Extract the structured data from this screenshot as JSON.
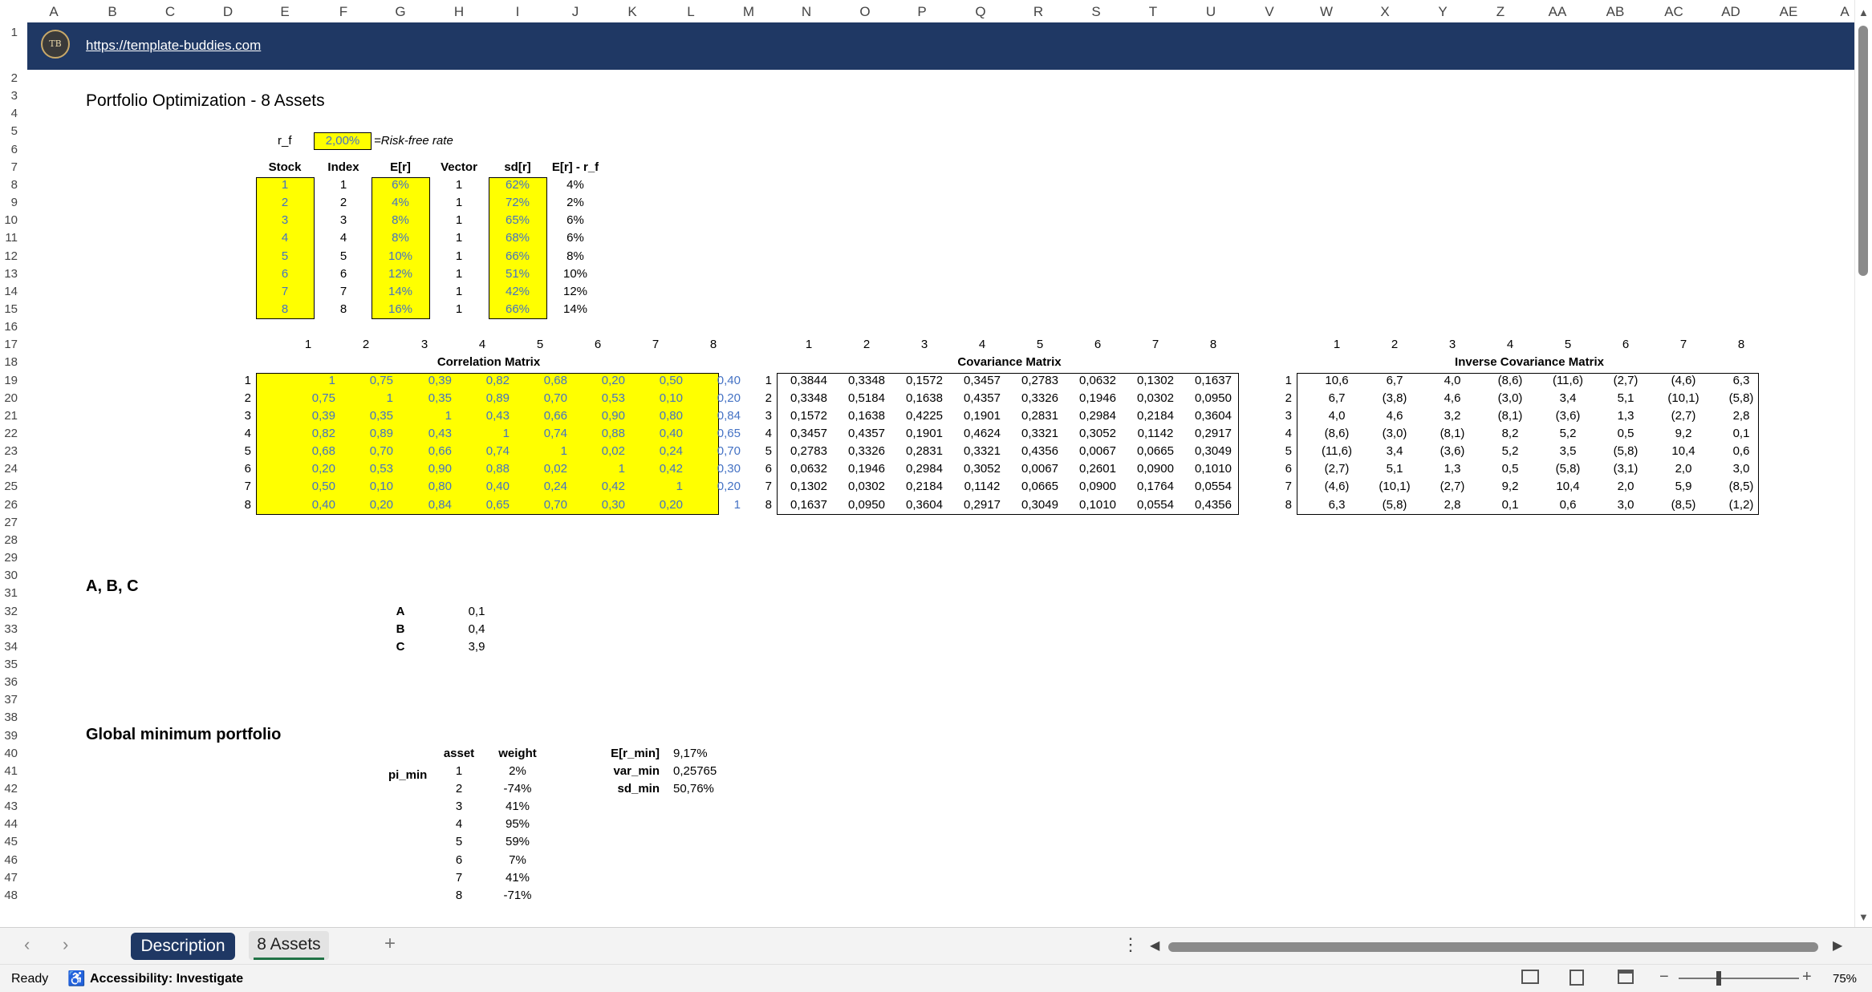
{
  "columns": [
    "A",
    "B",
    "C",
    "D",
    "E",
    "F",
    "G",
    "H",
    "I",
    "J",
    "K",
    "L",
    "M",
    "N",
    "O",
    "P",
    "Q",
    "R",
    "S",
    "T",
    "U",
    "V",
    "W",
    "X",
    "Y",
    "Z",
    "AA",
    "AB",
    "AC",
    "AD",
    "AE",
    "A"
  ],
  "link": "https://template-buddies.com",
  "logo_text": "TB",
  "title": "Portfolio Optimization - 8 Assets",
  "rf": {
    "label": "r_f",
    "value": "2,00%",
    "note": "=Risk-free rate"
  },
  "stock_table": {
    "headers": [
      "Stock",
      "Index",
      "E[r]",
      "Vector",
      "sd[r]",
      "E[r] - r_f"
    ],
    "rows": [
      [
        "1",
        "1",
        "6%",
        "1",
        "62%",
        "4%"
      ],
      [
        "2",
        "2",
        "4%",
        "1",
        "72%",
        "2%"
      ],
      [
        "3",
        "3",
        "8%",
        "1",
        "65%",
        "6%"
      ],
      [
        "4",
        "4",
        "8%",
        "1",
        "68%",
        "6%"
      ],
      [
        "5",
        "5",
        "10%",
        "1",
        "66%",
        "8%"
      ],
      [
        "6",
        "6",
        "12%",
        "1",
        "51%",
        "10%"
      ],
      [
        "7",
        "7",
        "14%",
        "1",
        "42%",
        "12%"
      ],
      [
        "8",
        "8",
        "16%",
        "1",
        "66%",
        "14%"
      ]
    ]
  },
  "matrix_index": [
    "1",
    "2",
    "3",
    "4",
    "5",
    "6",
    "7",
    "8"
  ],
  "correlation": {
    "title": "Correlation Matrix",
    "rows": [
      [
        "1",
        "0,75",
        "0,39",
        "0,82",
        "0,68",
        "0,20",
        "0,50",
        "0,40"
      ],
      [
        "0,75",
        "1",
        "0,35",
        "0,89",
        "0,70",
        "0,53",
        "0,10",
        "0,20"
      ],
      [
        "0,39",
        "0,35",
        "1",
        "0,43",
        "0,66",
        "0,90",
        "0,80",
        "0,84"
      ],
      [
        "0,82",
        "0,89",
        "0,43",
        "1",
        "0,74",
        "0,88",
        "0,40",
        "0,65"
      ],
      [
        "0,68",
        "0,70",
        "0,66",
        "0,74",
        "1",
        "0,02",
        "0,24",
        "0,70"
      ],
      [
        "0,20",
        "0,53",
        "0,90",
        "0,88",
        "0,02",
        "1",
        "0,42",
        "0,30"
      ],
      [
        "0,50",
        "0,10",
        "0,80",
        "0,40",
        "0,24",
        "0,42",
        "1",
        "0,20"
      ],
      [
        "0,40",
        "0,20",
        "0,84",
        "0,65",
        "0,70",
        "0,30",
        "0,20",
        "1"
      ]
    ]
  },
  "covariance": {
    "title": "Covariance Matrix",
    "rows": [
      [
        "0,3844",
        "0,3348",
        "0,1572",
        "0,3457",
        "0,2783",
        "0,0632",
        "0,1302",
        "0,1637"
      ],
      [
        "0,3348",
        "0,5184",
        "0,1638",
        "0,4357",
        "0,3326",
        "0,1946",
        "0,0302",
        "0,0950"
      ],
      [
        "0,1572",
        "0,1638",
        "0,4225",
        "0,1901",
        "0,2831",
        "0,2984",
        "0,2184",
        "0,3604"
      ],
      [
        "0,3457",
        "0,4357",
        "0,1901",
        "0,4624",
        "0,3321",
        "0,3052",
        "0,1142",
        "0,2917"
      ],
      [
        "0,2783",
        "0,3326",
        "0,2831",
        "0,3321",
        "0,4356",
        "0,0067",
        "0,0665",
        "0,3049"
      ],
      [
        "0,0632",
        "0,1946",
        "0,2984",
        "0,3052",
        "0,0067",
        "0,2601",
        "0,0900",
        "0,1010"
      ],
      [
        "0,1302",
        "0,0302",
        "0,2184",
        "0,1142",
        "0,0665",
        "0,0900",
        "0,1764",
        "0,0554"
      ],
      [
        "0,1637",
        "0,0950",
        "0,3604",
        "0,2917",
        "0,3049",
        "0,1010",
        "0,0554",
        "0,4356"
      ]
    ]
  },
  "inverse_covariance": {
    "title": "Inverse Covariance Matrix",
    "rows": [
      [
        "10,6",
        "6,7",
        "4,0",
        "(8,6)",
        "(11,6)",
        "(2,7)",
        "(4,6)",
        "6,3"
      ],
      [
        "6,7",
        "(3,8)",
        "4,6",
        "(3,0)",
        "3,4",
        "5,1",
        "(10,1)",
        "(5,8)"
      ],
      [
        "4,0",
        "4,6",
        "3,2",
        "(8,1)",
        "(3,6)",
        "1,3",
        "(2,7)",
        "2,8"
      ],
      [
        "(8,6)",
        "(3,0)",
        "(8,1)",
        "8,2",
        "5,2",
        "0,5",
        "9,2",
        "0,1"
      ],
      [
        "(11,6)",
        "3,4",
        "(3,6)",
        "5,2",
        "3,5",
        "(5,8)",
        "10,4",
        "0,6"
      ],
      [
        "(2,7)",
        "5,1",
        "1,3",
        "0,5",
        "(5,8)",
        "(3,1)",
        "2,0",
        "3,0"
      ],
      [
        "(4,6)",
        "(10,1)",
        "(2,7)",
        "9,2",
        "10,4",
        "2,0",
        "5,9",
        "(8,5)"
      ],
      [
        "6,3",
        "(5,8)",
        "2,8",
        "0,1",
        "0,6",
        "3,0",
        "(8,5)",
        "(1,2)"
      ]
    ]
  },
  "abc": {
    "title": "A, B, C",
    "rows": [
      [
        "A",
        "0,1"
      ],
      [
        "B",
        "0,4"
      ],
      [
        "C",
        "3,9"
      ]
    ]
  },
  "gmp": {
    "title": "Global minimum portfolio",
    "label": "pi_min",
    "headers": [
      "asset",
      "weight"
    ],
    "rows": [
      [
        "1",
        "2%"
      ],
      [
        "2",
        "-74%"
      ],
      [
        "3",
        "41%"
      ],
      [
        "4",
        "95%"
      ],
      [
        "5",
        "59%"
      ],
      [
        "6",
        "7%"
      ],
      [
        "7",
        "41%"
      ],
      [
        "8",
        "-71%"
      ]
    ],
    "stats": [
      [
        "E[r_min]",
        "9,17%"
      ],
      [
        "var_min",
        "0,25765"
      ],
      [
        "sd_min",
        "50,76%"
      ]
    ]
  },
  "tabs": {
    "tab1": "Description",
    "tab2": "8 Assets",
    "add": "+"
  },
  "status": {
    "ready": "Ready",
    "accessibility": "Accessibility: Investigate",
    "zoom": "75%"
  },
  "colors": {
    "band": "#1f3864",
    "input_fill": "#ffff00",
    "input_text": "#4472c4"
  }
}
